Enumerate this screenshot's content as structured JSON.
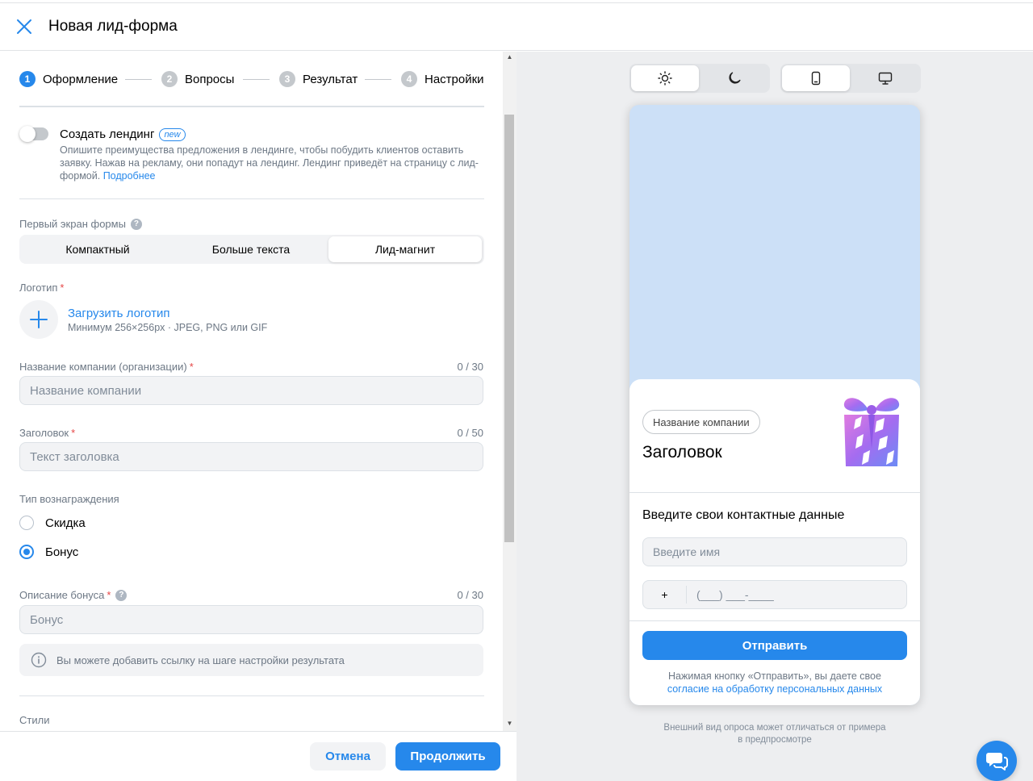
{
  "header": {
    "title": "Новая лид-форма"
  },
  "steps": [
    {
      "num": "1",
      "label": "Оформление",
      "active": true
    },
    {
      "num": "2",
      "label": "Вопросы",
      "active": false
    },
    {
      "num": "3",
      "label": "Результат",
      "active": false
    },
    {
      "num": "4",
      "label": "Настройки",
      "active": false
    }
  ],
  "landing": {
    "toggle_label": "Создать лендинг",
    "badge": "new",
    "enabled": false,
    "description": "Опишите преимущества предложения в лендинге, чтобы побудить клиентов оставить заявку. Нажав на рекламу, они попадут на лендинг. Лендинг приведёт на страницу с лид-формой.",
    "more_link": "Подробнее"
  },
  "first_screen": {
    "label": "Первый экран формы",
    "options": [
      "Компактный",
      "Больше текста",
      "Лид-магнит"
    ],
    "selected": "Лид-магнит"
  },
  "logo": {
    "label": "Логотип",
    "upload_link": "Загрузить логотип",
    "hint": "Минимум 256×256px · JPEG, PNG или GIF"
  },
  "company": {
    "label": "Название компании (организации)",
    "counter": "0 / 30",
    "placeholder": "Название компании",
    "value": ""
  },
  "headline": {
    "label": "Заголовок",
    "counter": "0 / 50",
    "placeholder": "Текст заголовка",
    "value": ""
  },
  "reward": {
    "label": "Тип вознаграждения",
    "options": [
      {
        "label": "Скидка",
        "checked": false
      },
      {
        "label": "Бонус",
        "checked": true
      }
    ]
  },
  "bonus": {
    "label": "Описание бонуса",
    "counter": "0 / 30",
    "placeholder": "Бонус",
    "value": ""
  },
  "info": {
    "text": "Вы можете добавить ссылку на шаге настройки результата"
  },
  "styles": {
    "label": "Стили"
  },
  "footer": {
    "cancel": "Отмена",
    "continue": "Продолжить"
  },
  "preview": {
    "theme_toggle": {
      "selected": "light",
      "icons": [
        "sun-icon",
        "moon-icon"
      ]
    },
    "device_toggle": {
      "selected": "mobile",
      "icons": [
        "phone-icon",
        "desktop-icon"
      ]
    },
    "company_chip": "Название компании",
    "title": "Заголовок",
    "contacts_title": "Введите свои контактные данные",
    "name_placeholder": "Введите имя",
    "phone_prefix": "+",
    "phone_mask": "(___) ___-____",
    "send_button": "Отправить",
    "consent_text": "Нажимая кнопку «Отправить», вы даете свое",
    "consent_link": "согласие на обработку персональных данных",
    "disclaimer": "Внешний вид опроса может отличаться от примера в предпросмотре"
  },
  "colors": {
    "accent": "#2688eb",
    "preview_background": "#cce0f7",
    "panel_background": "#edeef0",
    "required": "#e64646"
  }
}
